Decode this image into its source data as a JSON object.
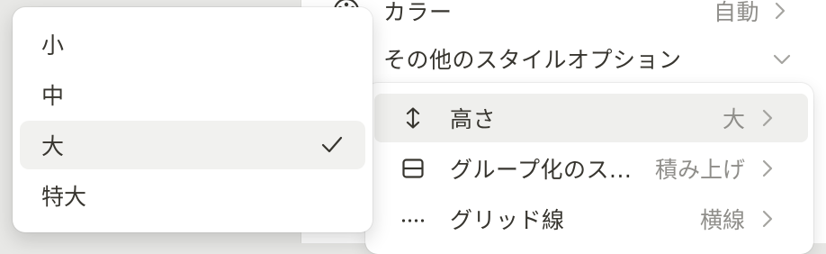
{
  "background_menu": {
    "color_row": {
      "label": "カラー",
      "value": "自動",
      "icon": "palette-icon"
    },
    "more_style_row": {
      "label": "その他のスタイルオプション"
    }
  },
  "submenu": {
    "items": [
      {
        "label": "高さ",
        "value": "大",
        "icon": "vertical-arrows-icon"
      },
      {
        "label": "グループ化のス...",
        "value": "積み上げ",
        "icon": "group-box-icon"
      },
      {
        "label": "グリッド線",
        "value": "横線",
        "icon": "dotted-line-icon"
      }
    ]
  },
  "dropdown": {
    "options": [
      {
        "label": "小"
      },
      {
        "label": "中"
      },
      {
        "label": "大",
        "selected": true
      },
      {
        "label": "特大"
      }
    ]
  },
  "colors": {
    "text": "#37352f",
    "muted": "#8f8e8a",
    "hover": "#efefed",
    "selected": "#f1f1ef"
  }
}
